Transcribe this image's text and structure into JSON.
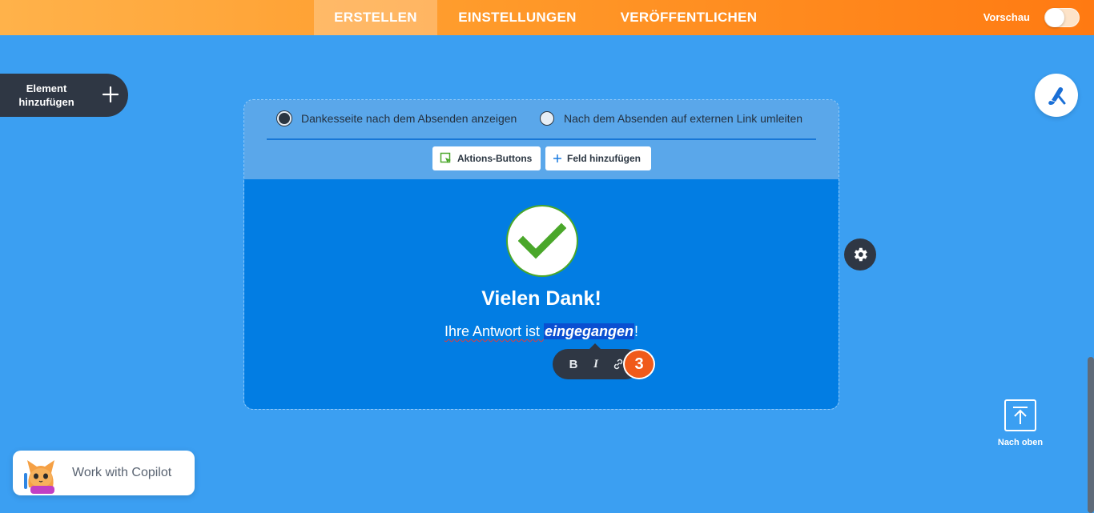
{
  "topbar": {
    "tabs": [
      {
        "label": "ERSTELLEN",
        "active": true
      },
      {
        "label": "EINSTELLUNGEN",
        "active": false
      },
      {
        "label": "VERÖFFENTLICHEN",
        "active": false
      }
    ],
    "preview_label": "Vorschau",
    "preview_enabled": false
  },
  "sidebar": {
    "add_element_label": "Element hinzufügen"
  },
  "card": {
    "radio_options": [
      {
        "label": "Dankesseite nach dem Absenden anzeigen",
        "selected": true
      },
      {
        "label": "Nach dem Absenden auf externen Link umleiten",
        "selected": false
      }
    ],
    "actions_button": "Aktions-Buttons",
    "add_field_button": "Feld hinzufügen",
    "title": "Vielen Dank!",
    "message_before": "Ihre Antwort ist ",
    "message_selected": "eingegangen",
    "message_after": "!"
  },
  "format_toolbar": {
    "bold": "B",
    "italic": "I",
    "link": "link-icon"
  },
  "step_badge": "3",
  "back_to_top_label": "Nach oben",
  "copilot_label": "Work with Copilot",
  "colors": {
    "topbar_start": "#ffb24a",
    "topbar_end": "#ff7a12",
    "background": "#3b9ff2",
    "card_body": "#027de3",
    "dark": "#2f3744",
    "check_green": "#4aa72a",
    "badge": "#f05a1a"
  }
}
